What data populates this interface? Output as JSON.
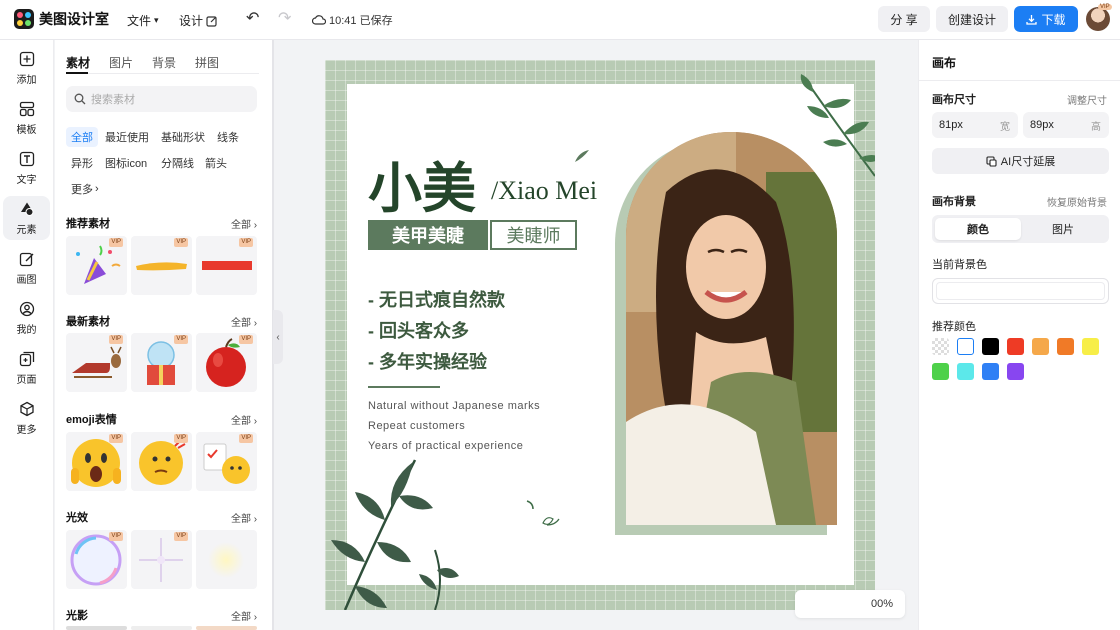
{
  "app": {
    "title": "美图设计室",
    "menu": {
      "file": "文件",
      "design": "设计"
    },
    "saved": "10:41 已保存",
    "share_label": "分 享",
    "create_label": "创建设计",
    "download_label": "下载",
    "vip": "VIP"
  },
  "leftnav": [
    {
      "label": "添加",
      "icon": "add-icon"
    },
    {
      "label": "模板",
      "icon": "template-icon"
    },
    {
      "label": "文字",
      "icon": "text-icon"
    },
    {
      "label": "元素",
      "icon": "element-icon"
    },
    {
      "label": "画图",
      "icon": "draw-icon"
    },
    {
      "label": "我的",
      "icon": "user-icon"
    },
    {
      "label": "页面",
      "icon": "page-icon"
    },
    {
      "label": "更多",
      "icon": "more-icon"
    }
  ],
  "panel": {
    "tabs": [
      "素材",
      "图片",
      "背景",
      "拼图"
    ],
    "search_placeholder": "搜索素材",
    "chips": [
      "全部",
      "最近使用",
      "基础形状",
      "线条",
      "异形",
      "图标icon",
      "分隔线",
      "箭头",
      "更多"
    ],
    "all_label": "全部",
    "sections": [
      "推荐素材",
      "最新素材",
      "emoji表情",
      "光效",
      "光影"
    ],
    "vip_label": "VIP"
  },
  "canvas": {
    "title_cn": "小美",
    "title_en": "/Xiao Mei",
    "tag1": "美甲美睫",
    "tag2": "美睫师",
    "bullets": [
      "- 无日式痕自然款",
      "- 回头客众多",
      "- 多年实操经验"
    ],
    "en_lines": [
      "Natural without Japanese marks",
      "Repeat customers",
      "Years of practical experience"
    ],
    "bg_color": "#b8cbb4",
    "accent": "#24452a"
  },
  "zoom": "00%",
  "right": {
    "title": "画布",
    "size_label": "画布尺寸",
    "adjust_label": "调整尺寸",
    "width_value": "81px",
    "width_unit": "宽",
    "height_value": "89px",
    "height_unit": "高",
    "ai_extend": "AI尺寸延展",
    "bg_label": "画布背景",
    "restore_label": "恢复原始背景",
    "seg_color": "颜色",
    "seg_image": "图片",
    "current_bg": "当前背景色",
    "recommend": "推荐颜色",
    "swatches": [
      "transparent",
      "#ffffff",
      "#000000",
      "#ee3b25",
      "#f5a84a",
      "#f07a27",
      "#f7ee48",
      "#4ed14a",
      "#5ce8ea",
      "#2f80f5",
      "#8846f0"
    ]
  }
}
